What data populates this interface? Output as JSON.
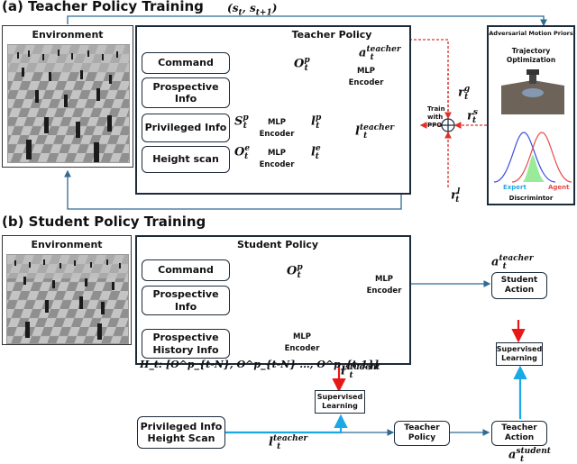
{
  "teacher_section": {
    "title": "(a) Teacher Policy Training",
    "environment_label": "Environment",
    "state_label": "(s_t, s_{t+1})",
    "policy_title": "Teacher Policy",
    "inputs": [
      "Command",
      "Prospective Info",
      "Privileged Info",
      "Height scan"
    ],
    "encoder_label": [
      "MLP",
      "Encoder"
    ],
    "symbols": {
      "o_p": {
        "base": "O",
        "sup": "p",
        "sub": "t"
      },
      "s_p": {
        "base": "S",
        "sup": "p",
        "sub": "t"
      },
      "o_e": {
        "base": "O",
        "sup": "e",
        "sub": "t"
      },
      "l_p": {
        "base": "l",
        "sup": "p",
        "sub": "t"
      },
      "l_e": {
        "base": "l",
        "sup": "e",
        "sub": "t"
      },
      "l_teacher": {
        "base": "l",
        "sup": "teacher",
        "sub": "t"
      },
      "a_teacher": {
        "base": "a",
        "sup": "teacher",
        "sub": "t"
      },
      "r_g": {
        "base": "r",
        "sup": "g",
        "sub": "t"
      },
      "r_s": {
        "base": "r",
        "sup": "s",
        "sub": "t"
      },
      "r_l": {
        "base": "r",
        "sup": "l",
        "sub": "t"
      }
    },
    "train_label": [
      "Train",
      "with",
      "PPO"
    ],
    "amp": {
      "title": "Adversarial Motion Priors",
      "subtitle": [
        "Trajectory",
        "Optimization"
      ],
      "expert_label": "Expert",
      "agent_label": "Agent",
      "discriminator_label": "Discrimintor",
      "colors": {
        "expert": "#3a4fe0",
        "agent": "#e84a4a",
        "overlap": "#8ee88e",
        "expert_text": "#2aa7e0"
      }
    }
  },
  "student_section": {
    "title": "(b) Student Policy Training",
    "environment_label": "Environment",
    "policy_title": "Student Policy",
    "inputs": [
      "Command",
      "Prospective Info",
      "Prospective History Info"
    ],
    "history_formula": "H_t: [O^p_{t-N}, O^p_{t-N} ..., O^p_{t-1}]",
    "symbols": {
      "o_p": {
        "base": "O",
        "sup": "p",
        "sub": "t"
      },
      "l_student": {
        "base": "l",
        "sup": "student",
        "sub": "t"
      },
      "l_teacher": {
        "base": "l",
        "sup": "teacher",
        "sub": "t"
      },
      "a_teacher": {
        "base": "a",
        "sup": "teacher",
        "sub": "t"
      },
      "a_student": {
        "base": "a",
        "sup": "student",
        "sub": "t"
      },
      "h_base": "H",
      "h_sub": "t"
    },
    "student_action": "Student Action",
    "supervised_learning": "Supervised Learning",
    "privileged_box": [
      "Privileged Info",
      "Height Scan"
    ],
    "teacher_policy": "Teacher Policy",
    "teacher_action": "Teacher Action"
  },
  "colors": {
    "wire": "#2e6a93",
    "dashed_red": "#e0302a",
    "supervision_red": "#e81818",
    "supervision_blue": "#1aa8e6",
    "frame": "#1c2b3a"
  }
}
